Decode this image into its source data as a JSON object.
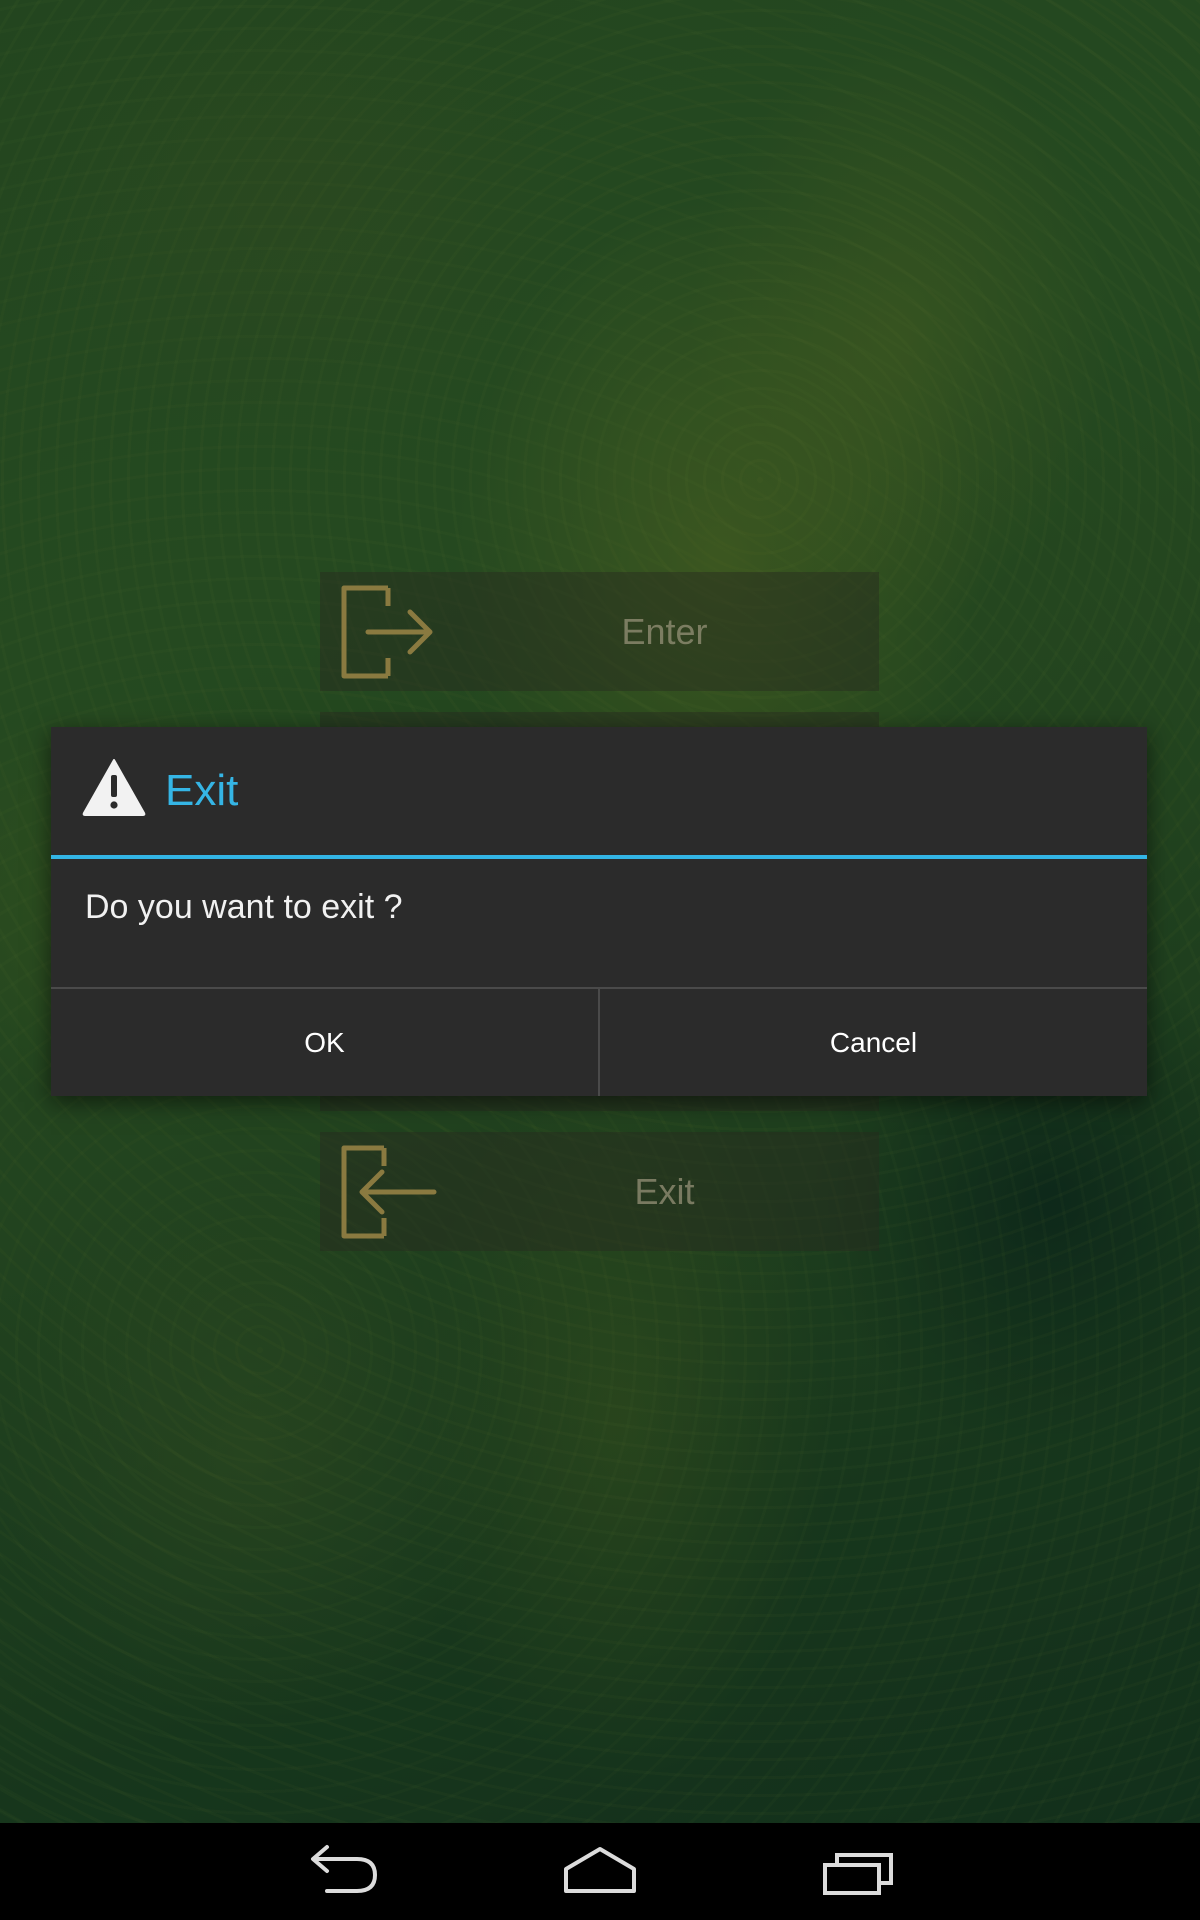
{
  "background_menu": {
    "items": [
      {
        "label": "Enter",
        "icon": "enter-icon"
      },
      {
        "label": "Exit",
        "icon": "exit-icon"
      }
    ]
  },
  "dialog": {
    "icon": "warning-icon",
    "title": "Exit",
    "message": "Do you want to exit ?",
    "ok_label": "OK",
    "cancel_label": "Cancel",
    "accent_color": "#33b5e5",
    "background_color": "#2b2b2b"
  },
  "navigation_bar": {
    "buttons": [
      "back-icon",
      "home-icon",
      "recent-apps-icon"
    ]
  },
  "colors": {
    "wallpaper": "#2b5527",
    "menu_icon": "#8a7a40"
  }
}
